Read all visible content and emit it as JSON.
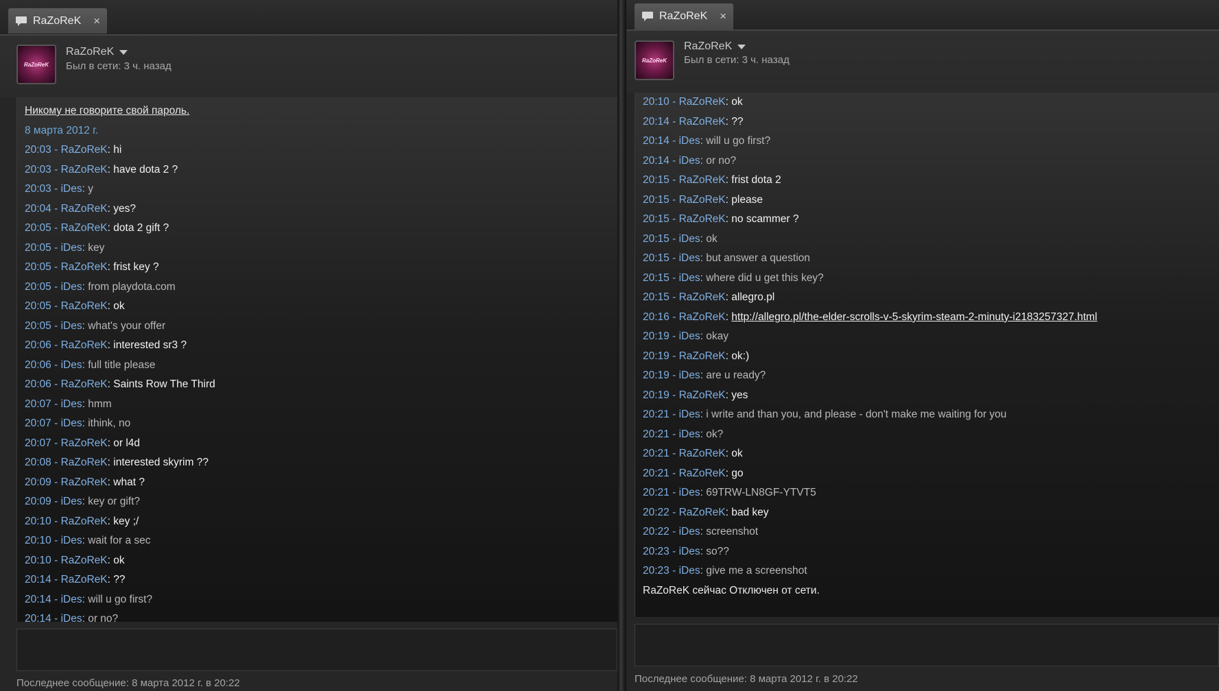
{
  "colors": {
    "timestamp": "#7fb0e4",
    "date": "#6ea8d8",
    "razorek_message": "#f2f2f2",
    "ides_message": "#b9b9b9"
  },
  "left": {
    "tab": {
      "label": "RaZoReK",
      "close": "×",
      "icon": "chat-bubble-icon"
    },
    "profile": {
      "name": "RaZoReK",
      "status": "Был в сети: 3 ч. назад",
      "avatar_text": "RaZoReK"
    },
    "warning": "Никому не говорите свой пароль.",
    "date": "8 марта 2012 г.",
    "messages": [
      {
        "time": "20:03",
        "sep": " - ",
        "name": "RaZoReK",
        "colon": ": ",
        "text": "hi",
        "from": "razorek"
      },
      {
        "time": "20:03",
        "sep": " - ",
        "name": "RaZoReK",
        "colon": ": ",
        "text": "have dota 2 ?",
        "from": "razorek"
      },
      {
        "time": "20:03",
        "sep": " - ",
        "name": "iDes",
        "colon": ": ",
        "text": "y",
        "from": "ides"
      },
      {
        "time": "20:04",
        "sep": " - ",
        "name": "RaZoReK",
        "colon": ": ",
        "text": "yes?",
        "from": "razorek"
      },
      {
        "time": "20:05",
        "sep": " - ",
        "name": "RaZoReK",
        "colon": ": ",
        "text": "dota 2 gift ?",
        "from": "razorek"
      },
      {
        "time": "20:05",
        "sep": " - ",
        "name": "iDes",
        "colon": ": ",
        "text": "key",
        "from": "ides"
      },
      {
        "time": "20:05",
        "sep": " - ",
        "name": "RaZoReK",
        "colon": ": ",
        "text": "frist key ?",
        "from": "razorek"
      },
      {
        "time": "20:05",
        "sep": " - ",
        "name": "iDes",
        "colon": ": ",
        "text": "from playdota.com",
        "from": "ides"
      },
      {
        "time": "20:05",
        "sep": " - ",
        "name": "RaZoReK",
        "colon": ": ",
        "text": "ok",
        "from": "razorek"
      },
      {
        "time": "20:05",
        "sep": " - ",
        "name": "iDes",
        "colon": ": ",
        "text": "what's your offer",
        "from": "ides"
      },
      {
        "time": "20:06",
        "sep": " - ",
        "name": "RaZoReK",
        "colon": ": ",
        "text": "interested sr3 ?",
        "from": "razorek"
      },
      {
        "time": "20:06",
        "sep": " - ",
        "name": "iDes",
        "colon": ": ",
        "text": "full title please",
        "from": "ides"
      },
      {
        "time": "20:06",
        "sep": " - ",
        "name": "RaZoReK",
        "colon": ": ",
        "text": "Saints Row The Third",
        "from": "razorek"
      },
      {
        "time": "20:07",
        "sep": " - ",
        "name": "iDes",
        "colon": ": ",
        "text": "hmm",
        "from": "ides"
      },
      {
        "time": "20:07",
        "sep": " - ",
        "name": "iDes",
        "colon": ": ",
        "text": "ithink, no",
        "from": "ides"
      },
      {
        "time": "20:07",
        "sep": " - ",
        "name": "RaZoReK",
        "colon": ": ",
        "text": "or l4d",
        "from": "razorek"
      },
      {
        "time": "20:08",
        "sep": " - ",
        "name": "RaZoReK",
        "colon": ": ",
        "text": "interested skyrim ??",
        "from": "razorek"
      },
      {
        "time": "20:09",
        "sep": " - ",
        "name": "RaZoReK",
        "colon": ": ",
        "text": "what ?",
        "from": "razorek"
      },
      {
        "time": "20:09",
        "sep": " - ",
        "name": "iDes",
        "colon": ": ",
        "text": "key or gift?",
        "from": "ides"
      },
      {
        "time": "20:10",
        "sep": " - ",
        "name": "RaZoReK",
        "colon": ": ",
        "text": "key ;/",
        "from": "razorek"
      },
      {
        "time": "20:10",
        "sep": " - ",
        "name": "iDes",
        "colon": ": ",
        "text": "wait for a sec",
        "from": "ides"
      },
      {
        "time": "20:10",
        "sep": " - ",
        "name": "RaZoReK",
        "colon": ": ",
        "text": "ok",
        "from": "razorek"
      },
      {
        "time": "20:14",
        "sep": " - ",
        "name": "RaZoReK",
        "colon": ": ",
        "text": "??",
        "from": "razorek"
      },
      {
        "time": "20:14",
        "sep": " - ",
        "name": "iDes",
        "colon": ": ",
        "text": "will u go first?",
        "from": "ides"
      },
      {
        "time": "20:14",
        "sep": " - ",
        "name": "iDes",
        "colon": ": ",
        "text": "or no?",
        "from": "ides"
      }
    ],
    "footer": "Последнее сообщение: 8 марта 2012 г. в 20:22"
  },
  "right": {
    "tab": {
      "label": "RaZoReK",
      "close": "×",
      "icon": "chat-bubble-icon"
    },
    "profile": {
      "name": "RaZoReK",
      "status": "Был в сети: 3 ч. назад",
      "avatar_text": "RaZoReK"
    },
    "messages": [
      {
        "time": "20:10",
        "sep": " - ",
        "name": "RaZoReK",
        "colon": ": ",
        "text": "ok",
        "from": "razorek"
      },
      {
        "time": "20:14",
        "sep": " - ",
        "name": "RaZoReK",
        "colon": ": ",
        "text": "??",
        "from": "razorek"
      },
      {
        "time": "20:14",
        "sep": " - ",
        "name": "iDes",
        "colon": ": ",
        "text": "will u go first?",
        "from": "ides"
      },
      {
        "time": "20:14",
        "sep": " - ",
        "name": "iDes",
        "colon": ": ",
        "text": "or no?",
        "from": "ides"
      },
      {
        "time": "20:15",
        "sep": " - ",
        "name": "RaZoReK",
        "colon": ": ",
        "text": "frist dota 2",
        "from": "razorek"
      },
      {
        "time": "20:15",
        "sep": " - ",
        "name": "RaZoReK",
        "colon": ": ",
        "text": "please",
        "from": "razorek"
      },
      {
        "time": "20:15",
        "sep": " - ",
        "name": "RaZoReK",
        "colon": ": ",
        "text": "no scammer ?",
        "from": "razorek"
      },
      {
        "time": "20:15",
        "sep": " - ",
        "name": "iDes",
        "colon": ": ",
        "text": "ok",
        "from": "ides"
      },
      {
        "time": "20:15",
        "sep": " - ",
        "name": "iDes",
        "colon": ": ",
        "text": "but answer a question",
        "from": "ides"
      },
      {
        "time": "20:15",
        "sep": " - ",
        "name": "iDes",
        "colon": ": ",
        "text": "where did u get this key?",
        "from": "ides"
      },
      {
        "time": "20:15",
        "sep": " - ",
        "name": "RaZoReK",
        "colon": ": ",
        "text": "allegro.pl",
        "from": "razorek"
      },
      {
        "time": "20:16",
        "sep": " - ",
        "name": "RaZoReK",
        "colon": ": ",
        "text": "http://allegro.pl/the-elder-scrolls-v-5-skyrim-steam-2-minuty-i2183257327.html",
        "from": "razorek",
        "link": true
      },
      {
        "time": "20:19",
        "sep": " - ",
        "name": "iDes",
        "colon": ": ",
        "text": "okay",
        "from": "ides"
      },
      {
        "time": "20:19",
        "sep": " - ",
        "name": "RaZoReK",
        "colon": ": ",
        "text": "ok:)",
        "from": "razorek"
      },
      {
        "time": "20:19",
        "sep": " - ",
        "name": "iDes",
        "colon": ": ",
        "text": "are u ready?",
        "from": "ides"
      },
      {
        "time": "20:19",
        "sep": " - ",
        "name": "RaZoReK",
        "colon": ": ",
        "text": "yes",
        "from": "razorek"
      },
      {
        "time": "20:21",
        "sep": " - ",
        "name": "iDes",
        "colon": ": ",
        "text": "i write and than you, and please - don't make me waiting for you",
        "from": "ides"
      },
      {
        "time": "20:21",
        "sep": " - ",
        "name": "iDes",
        "colon": ": ",
        "text": "ok?",
        "from": "ides"
      },
      {
        "time": "20:21",
        "sep": " - ",
        "name": "RaZoReK",
        "colon": ": ",
        "text": "ok",
        "from": "razorek"
      },
      {
        "time": "20:21",
        "sep": " - ",
        "name": "RaZoReK",
        "colon": ": ",
        "text": "go",
        "from": "razorek"
      },
      {
        "time": "20:21",
        "sep": " - ",
        "name": "iDes",
        "colon": ": ",
        "text": "69TRW-LN8GF-YTVT5",
        "from": "ides"
      },
      {
        "time": "20:22",
        "sep": " - ",
        "name": "RaZoReK",
        "colon": ": ",
        "text": "bad key",
        "from": "razorek"
      },
      {
        "time": "20:22",
        "sep": " - ",
        "name": "iDes",
        "colon": ": ",
        "text": "screenshot",
        "from": "ides"
      },
      {
        "time": "20:23",
        "sep": " - ",
        "name": "iDes",
        "colon": ": ",
        "text": "so??",
        "from": "ides"
      },
      {
        "time": "20:23",
        "sep": " - ",
        "name": "iDes",
        "colon": ": ",
        "text": "give me a screenshot",
        "from": "ides"
      }
    ],
    "offline_notice": "RaZoReK сейчас Отключен от сети.",
    "footer": "Последнее сообщение: 8 марта 2012 г. в 20:22"
  }
}
